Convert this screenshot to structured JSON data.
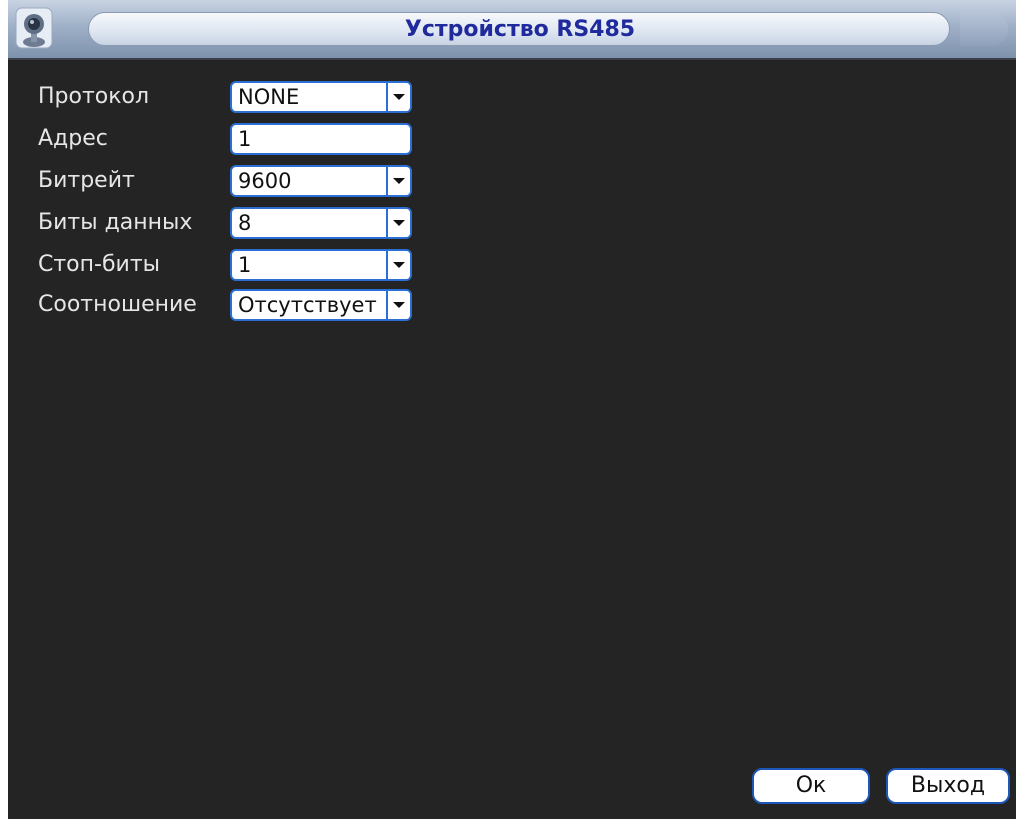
{
  "window": {
    "title": "Устройство RS485",
    "icon": "camera-icon"
  },
  "form": {
    "fields": [
      {
        "label": "Протокол",
        "value": "NONE",
        "control": "dropdown"
      },
      {
        "label": "Адрес",
        "value": "1",
        "control": "textbox"
      },
      {
        "label": "Битрейт",
        "value": "9600",
        "control": "dropdown"
      },
      {
        "label": "Биты данных",
        "value": "8",
        "control": "dropdown"
      },
      {
        "label": "Стоп-биты",
        "value": "1",
        "control": "dropdown"
      },
      {
        "label": "Соотношение",
        "value": "Отсутствует",
        "control": "dropdown"
      }
    ]
  },
  "buttons": {
    "ok_label": "Ок",
    "exit_label": "Выход"
  },
  "colors": {
    "background": "#242424",
    "control_border": "#2b6fd4",
    "title_text": "#1f2a9c"
  }
}
